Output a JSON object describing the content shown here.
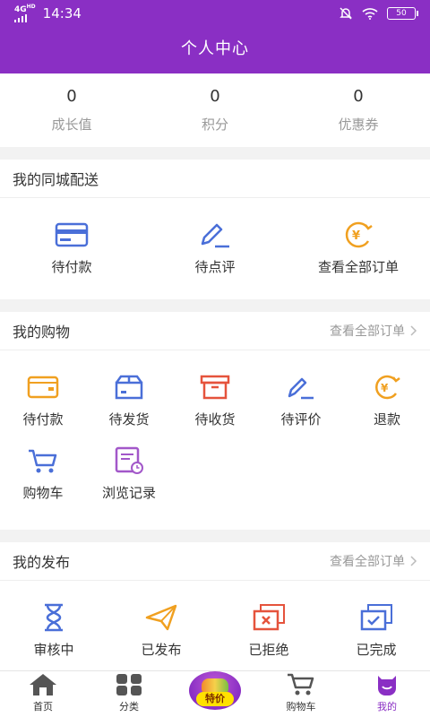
{
  "status_bar": {
    "network": "4G",
    "network_sub": "HD",
    "time": "14:34",
    "battery": "50"
  },
  "header": {
    "title": "个人中心"
  },
  "stats": [
    {
      "value": "0",
      "label": "成长值"
    },
    {
      "value": "0",
      "label": "积分"
    },
    {
      "value": "0",
      "label": "优惠券"
    }
  ],
  "delivery": {
    "title": "我的同城配送",
    "items": [
      {
        "label": "待付款",
        "icon": "card-icon"
      },
      {
        "label": "待点评",
        "icon": "pen-icon"
      },
      {
        "label": "查看全部订单",
        "icon": "yen-coin-icon"
      }
    ]
  },
  "shopping": {
    "title": "我的购物",
    "more": "查看全部订单",
    "items": [
      {
        "label": "待付款",
        "icon": "wallet-icon"
      },
      {
        "label": "待发货",
        "icon": "box-icon"
      },
      {
        "label": "待收货",
        "icon": "package-icon"
      },
      {
        "label": "待评价",
        "icon": "pen-icon"
      },
      {
        "label": "退款",
        "icon": "yen-coin-icon"
      },
      {
        "label": "购物车",
        "icon": "cart-icon"
      },
      {
        "label": "浏览记录",
        "icon": "history-icon"
      }
    ]
  },
  "publish": {
    "title": "我的发布",
    "more": "查看全部订单",
    "items": [
      {
        "label": "审核中",
        "icon": "hourglass-icon"
      },
      {
        "label": "已发布",
        "icon": "paper-plane-icon"
      },
      {
        "label": "已拒绝",
        "icon": "rejected-icon"
      },
      {
        "label": "已完成",
        "icon": "completed-icon"
      }
    ]
  },
  "tabbar": {
    "items": [
      {
        "label": "首页",
        "icon": "home-icon"
      },
      {
        "label": "分类",
        "icon": "category-icon"
      },
      {
        "label": "特价",
        "icon": "promo-icon"
      },
      {
        "label": "购物车",
        "icon": "cart-icon"
      },
      {
        "label": "我的",
        "icon": "profile-icon"
      }
    ],
    "active": "我的"
  },
  "colors": {
    "brand": "#8a2fc4",
    "blue": "#4a6fd8",
    "orange": "#f0a020",
    "red": "#e5533c"
  }
}
